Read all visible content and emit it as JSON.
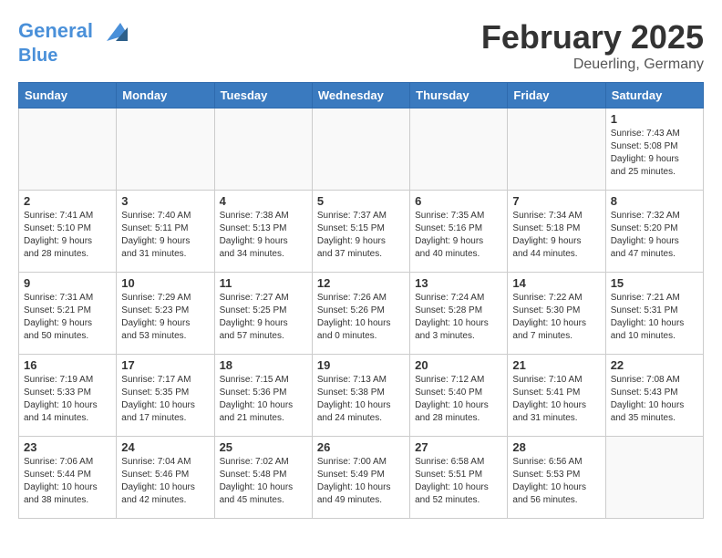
{
  "header": {
    "logo_line1": "General",
    "logo_line2": "Blue",
    "title": "February 2025",
    "subtitle": "Deuerling, Germany"
  },
  "days_of_week": [
    "Sunday",
    "Monday",
    "Tuesday",
    "Wednesday",
    "Thursday",
    "Friday",
    "Saturday"
  ],
  "weeks": [
    [
      {
        "day": "",
        "detail": ""
      },
      {
        "day": "",
        "detail": ""
      },
      {
        "day": "",
        "detail": ""
      },
      {
        "day": "",
        "detail": ""
      },
      {
        "day": "",
        "detail": ""
      },
      {
        "day": "",
        "detail": ""
      },
      {
        "day": "1",
        "detail": "Sunrise: 7:43 AM\nSunset: 5:08 PM\nDaylight: 9 hours\nand 25 minutes."
      }
    ],
    [
      {
        "day": "2",
        "detail": "Sunrise: 7:41 AM\nSunset: 5:10 PM\nDaylight: 9 hours\nand 28 minutes."
      },
      {
        "day": "3",
        "detail": "Sunrise: 7:40 AM\nSunset: 5:11 PM\nDaylight: 9 hours\nand 31 minutes."
      },
      {
        "day": "4",
        "detail": "Sunrise: 7:38 AM\nSunset: 5:13 PM\nDaylight: 9 hours\nand 34 minutes."
      },
      {
        "day": "5",
        "detail": "Sunrise: 7:37 AM\nSunset: 5:15 PM\nDaylight: 9 hours\nand 37 minutes."
      },
      {
        "day": "6",
        "detail": "Sunrise: 7:35 AM\nSunset: 5:16 PM\nDaylight: 9 hours\nand 40 minutes."
      },
      {
        "day": "7",
        "detail": "Sunrise: 7:34 AM\nSunset: 5:18 PM\nDaylight: 9 hours\nand 44 minutes."
      },
      {
        "day": "8",
        "detail": "Sunrise: 7:32 AM\nSunset: 5:20 PM\nDaylight: 9 hours\nand 47 minutes."
      }
    ],
    [
      {
        "day": "9",
        "detail": "Sunrise: 7:31 AM\nSunset: 5:21 PM\nDaylight: 9 hours\nand 50 minutes."
      },
      {
        "day": "10",
        "detail": "Sunrise: 7:29 AM\nSunset: 5:23 PM\nDaylight: 9 hours\nand 53 minutes."
      },
      {
        "day": "11",
        "detail": "Sunrise: 7:27 AM\nSunset: 5:25 PM\nDaylight: 9 hours\nand 57 minutes."
      },
      {
        "day": "12",
        "detail": "Sunrise: 7:26 AM\nSunset: 5:26 PM\nDaylight: 10 hours\nand 0 minutes."
      },
      {
        "day": "13",
        "detail": "Sunrise: 7:24 AM\nSunset: 5:28 PM\nDaylight: 10 hours\nand 3 minutes."
      },
      {
        "day": "14",
        "detail": "Sunrise: 7:22 AM\nSunset: 5:30 PM\nDaylight: 10 hours\nand 7 minutes."
      },
      {
        "day": "15",
        "detail": "Sunrise: 7:21 AM\nSunset: 5:31 PM\nDaylight: 10 hours\nand 10 minutes."
      }
    ],
    [
      {
        "day": "16",
        "detail": "Sunrise: 7:19 AM\nSunset: 5:33 PM\nDaylight: 10 hours\nand 14 minutes."
      },
      {
        "day": "17",
        "detail": "Sunrise: 7:17 AM\nSunset: 5:35 PM\nDaylight: 10 hours\nand 17 minutes."
      },
      {
        "day": "18",
        "detail": "Sunrise: 7:15 AM\nSunset: 5:36 PM\nDaylight: 10 hours\nand 21 minutes."
      },
      {
        "day": "19",
        "detail": "Sunrise: 7:13 AM\nSunset: 5:38 PM\nDaylight: 10 hours\nand 24 minutes."
      },
      {
        "day": "20",
        "detail": "Sunrise: 7:12 AM\nSunset: 5:40 PM\nDaylight: 10 hours\nand 28 minutes."
      },
      {
        "day": "21",
        "detail": "Sunrise: 7:10 AM\nSunset: 5:41 PM\nDaylight: 10 hours\nand 31 minutes."
      },
      {
        "day": "22",
        "detail": "Sunrise: 7:08 AM\nSunset: 5:43 PM\nDaylight: 10 hours\nand 35 minutes."
      }
    ],
    [
      {
        "day": "23",
        "detail": "Sunrise: 7:06 AM\nSunset: 5:44 PM\nDaylight: 10 hours\nand 38 minutes."
      },
      {
        "day": "24",
        "detail": "Sunrise: 7:04 AM\nSunset: 5:46 PM\nDaylight: 10 hours\nand 42 minutes."
      },
      {
        "day": "25",
        "detail": "Sunrise: 7:02 AM\nSunset: 5:48 PM\nDaylight: 10 hours\nand 45 minutes."
      },
      {
        "day": "26",
        "detail": "Sunrise: 7:00 AM\nSunset: 5:49 PM\nDaylight: 10 hours\nand 49 minutes."
      },
      {
        "day": "27",
        "detail": "Sunrise: 6:58 AM\nSunset: 5:51 PM\nDaylight: 10 hours\nand 52 minutes."
      },
      {
        "day": "28",
        "detail": "Sunrise: 6:56 AM\nSunset: 5:53 PM\nDaylight: 10 hours\nand 56 minutes."
      },
      {
        "day": "",
        "detail": ""
      }
    ]
  ]
}
